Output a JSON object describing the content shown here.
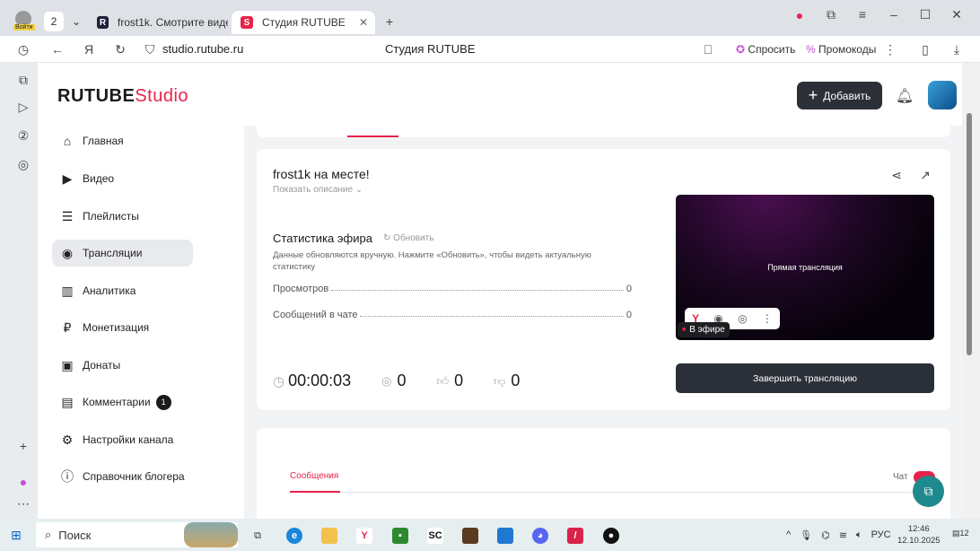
{
  "browser": {
    "profile_label": "Войти",
    "tab_count": "2",
    "tabs": [
      {
        "label": "frost1k. Смотрите видео",
        "icon": "R"
      },
      {
        "label": "Студия RUTUBE",
        "icon": "S"
      }
    ],
    "url": "studio.rutube.ru",
    "page_title": "Студия RUTUBE",
    "ask_label": "Спросить",
    "promo_label": "Промокоды"
  },
  "header": {
    "logo_main": "RUTUBE",
    "logo_studio": "Studio",
    "add_label": "Добавить"
  },
  "sidebar": {
    "items": [
      {
        "label": "Главная",
        "icon": "⌂"
      },
      {
        "label": "Видео",
        "icon": "▶"
      },
      {
        "label": "Плейлисты",
        "icon": "☰"
      },
      {
        "label": "Трансляции",
        "icon": "◉"
      },
      {
        "label": "Аналитика",
        "icon": "▥"
      },
      {
        "label": "Монетизация",
        "icon": "₽"
      },
      {
        "label": "Донаты",
        "icon": "▣"
      },
      {
        "label": "Комментарии",
        "icon": "▤",
        "badge": "1"
      },
      {
        "label": "Настройки канала",
        "icon": "⚙"
      },
      {
        "label": "Справочник блогера",
        "icon": "ⓘ"
      }
    ]
  },
  "stream": {
    "title": "frost1k на месте!",
    "show_description": "Показать описание",
    "stats_title": "Статистика эфира",
    "refresh_label": "Обновить",
    "stats_note": "Данные обновляются вручную. Нажмите «Обновить», чтобы видеть актуальную статистику",
    "stats": [
      {
        "label": "Просмотров",
        "value": "0"
      },
      {
        "label": "Сообщений в чате",
        "value": "0"
      }
    ],
    "duration": "00:00:03",
    "viewers": "0",
    "likes": "0",
    "dislikes": "0",
    "preview_text": "Прямая трансляция",
    "live_label": "В эфире",
    "end_button": "Завершить трансляцию"
  },
  "chat": {
    "tab_messages": "Сообщения",
    "chat_label": "Чат"
  },
  "taskbar": {
    "search": "Поиск",
    "lang": "РУС",
    "time": "12:46",
    "date": "12.10.2025",
    "notif_count": "12"
  },
  "colors": {
    "accent": "#e8234a",
    "dark": "#2b3038"
  }
}
